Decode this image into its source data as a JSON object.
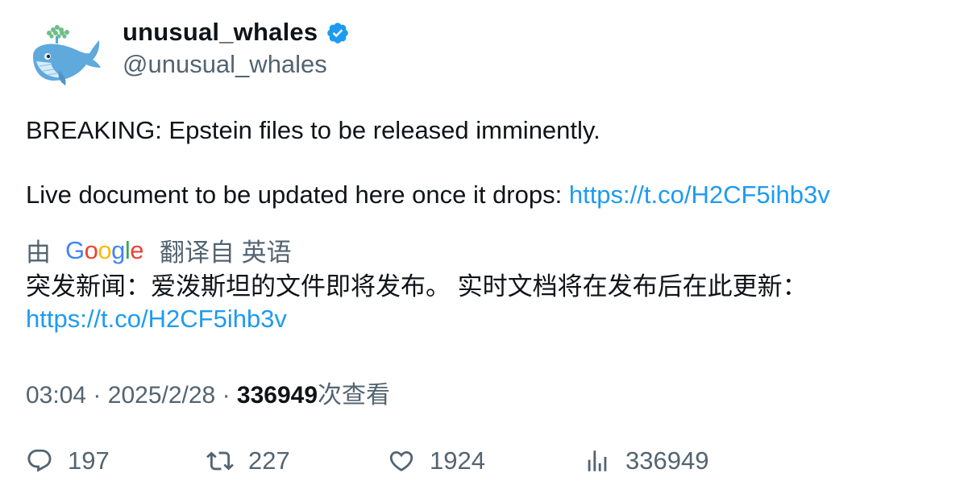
{
  "author": {
    "display_name": "unusual_whales",
    "handle": "@unusual_whales",
    "verified": true,
    "avatar_icon": "whale-avatar-icon",
    "verified_icon": "verified-badge-icon"
  },
  "tweet": {
    "line1": "BREAKING: Epstein files to be released imminently.",
    "line2_prefix": "Live document to be updated here once it drops: ",
    "line2_link": "https://t.co/H2CF5ihb3v"
  },
  "translation": {
    "prefix": "由",
    "provider": "Google",
    "suffix": "翻译自 英语",
    "text_line1": "突发新闻：爱泼斯坦的文件即将发布。 实时文档将在发布后在此更新：",
    "text_link": "https://t.co/H2CF5ihb3v"
  },
  "meta": {
    "time": "03:04",
    "sep1": "·",
    "date": "2025/2/28",
    "sep2": "·",
    "views_count": "336949",
    "views_label": "次查看"
  },
  "actions": {
    "replies": "197",
    "retweets": "227",
    "likes": "1924",
    "views": "336949"
  },
  "colors": {
    "link": "#1d9bf0",
    "secondary_text": "#536471",
    "primary_text": "#0f1419",
    "verified": "#1d9bf0"
  }
}
